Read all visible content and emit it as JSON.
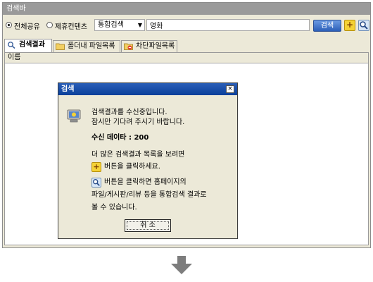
{
  "window": {
    "title": "검색바"
  },
  "toolbar": {
    "radio_all": "전체공유",
    "radio_partner": "제휴컨텐츠",
    "search_type": "통합검색",
    "search_value": "영화",
    "search_button": "검색"
  },
  "tabs": [
    {
      "label": "검색결과"
    },
    {
      "label": "폴더내 파일목록"
    },
    {
      "label": "차단파일목록"
    }
  ],
  "list": {
    "column_name": "이름"
  },
  "dialog": {
    "title": "검색",
    "close_glyph": "×",
    "line1": "검색결과를 수신중입니다.",
    "line2": "잠시만 기다려 주시기 바랍니다.",
    "received_label": "수신 데이타 : 200",
    "more_line": "더 많은 검색결과 목록을 보려면",
    "plus_line": "버튼을 클릭하세요.",
    "home_line1": "버튼을 클릭하면 홈페이지의",
    "home_line2": "파일/게시판/리뷰 등을 통합검색 결과로",
    "home_line3": "볼 수 있습니다.",
    "cancel_button": "취 소"
  },
  "colors": {
    "title_bar": "#9a9a9a",
    "dialog_title": "#2a5fb8",
    "search_button": "#3a6cc8",
    "plus_button": "#f5d235",
    "arrow": "#7d7d7d"
  },
  "icons": {
    "plus": "plus-icon",
    "magnifier": "magnifier-icon",
    "search_tab": "magnifier-icon",
    "folder_tab": "folder-icon",
    "block_tab": "block-folder-icon",
    "dialog": "computer-icon",
    "arrow": "arrow-down-icon"
  }
}
